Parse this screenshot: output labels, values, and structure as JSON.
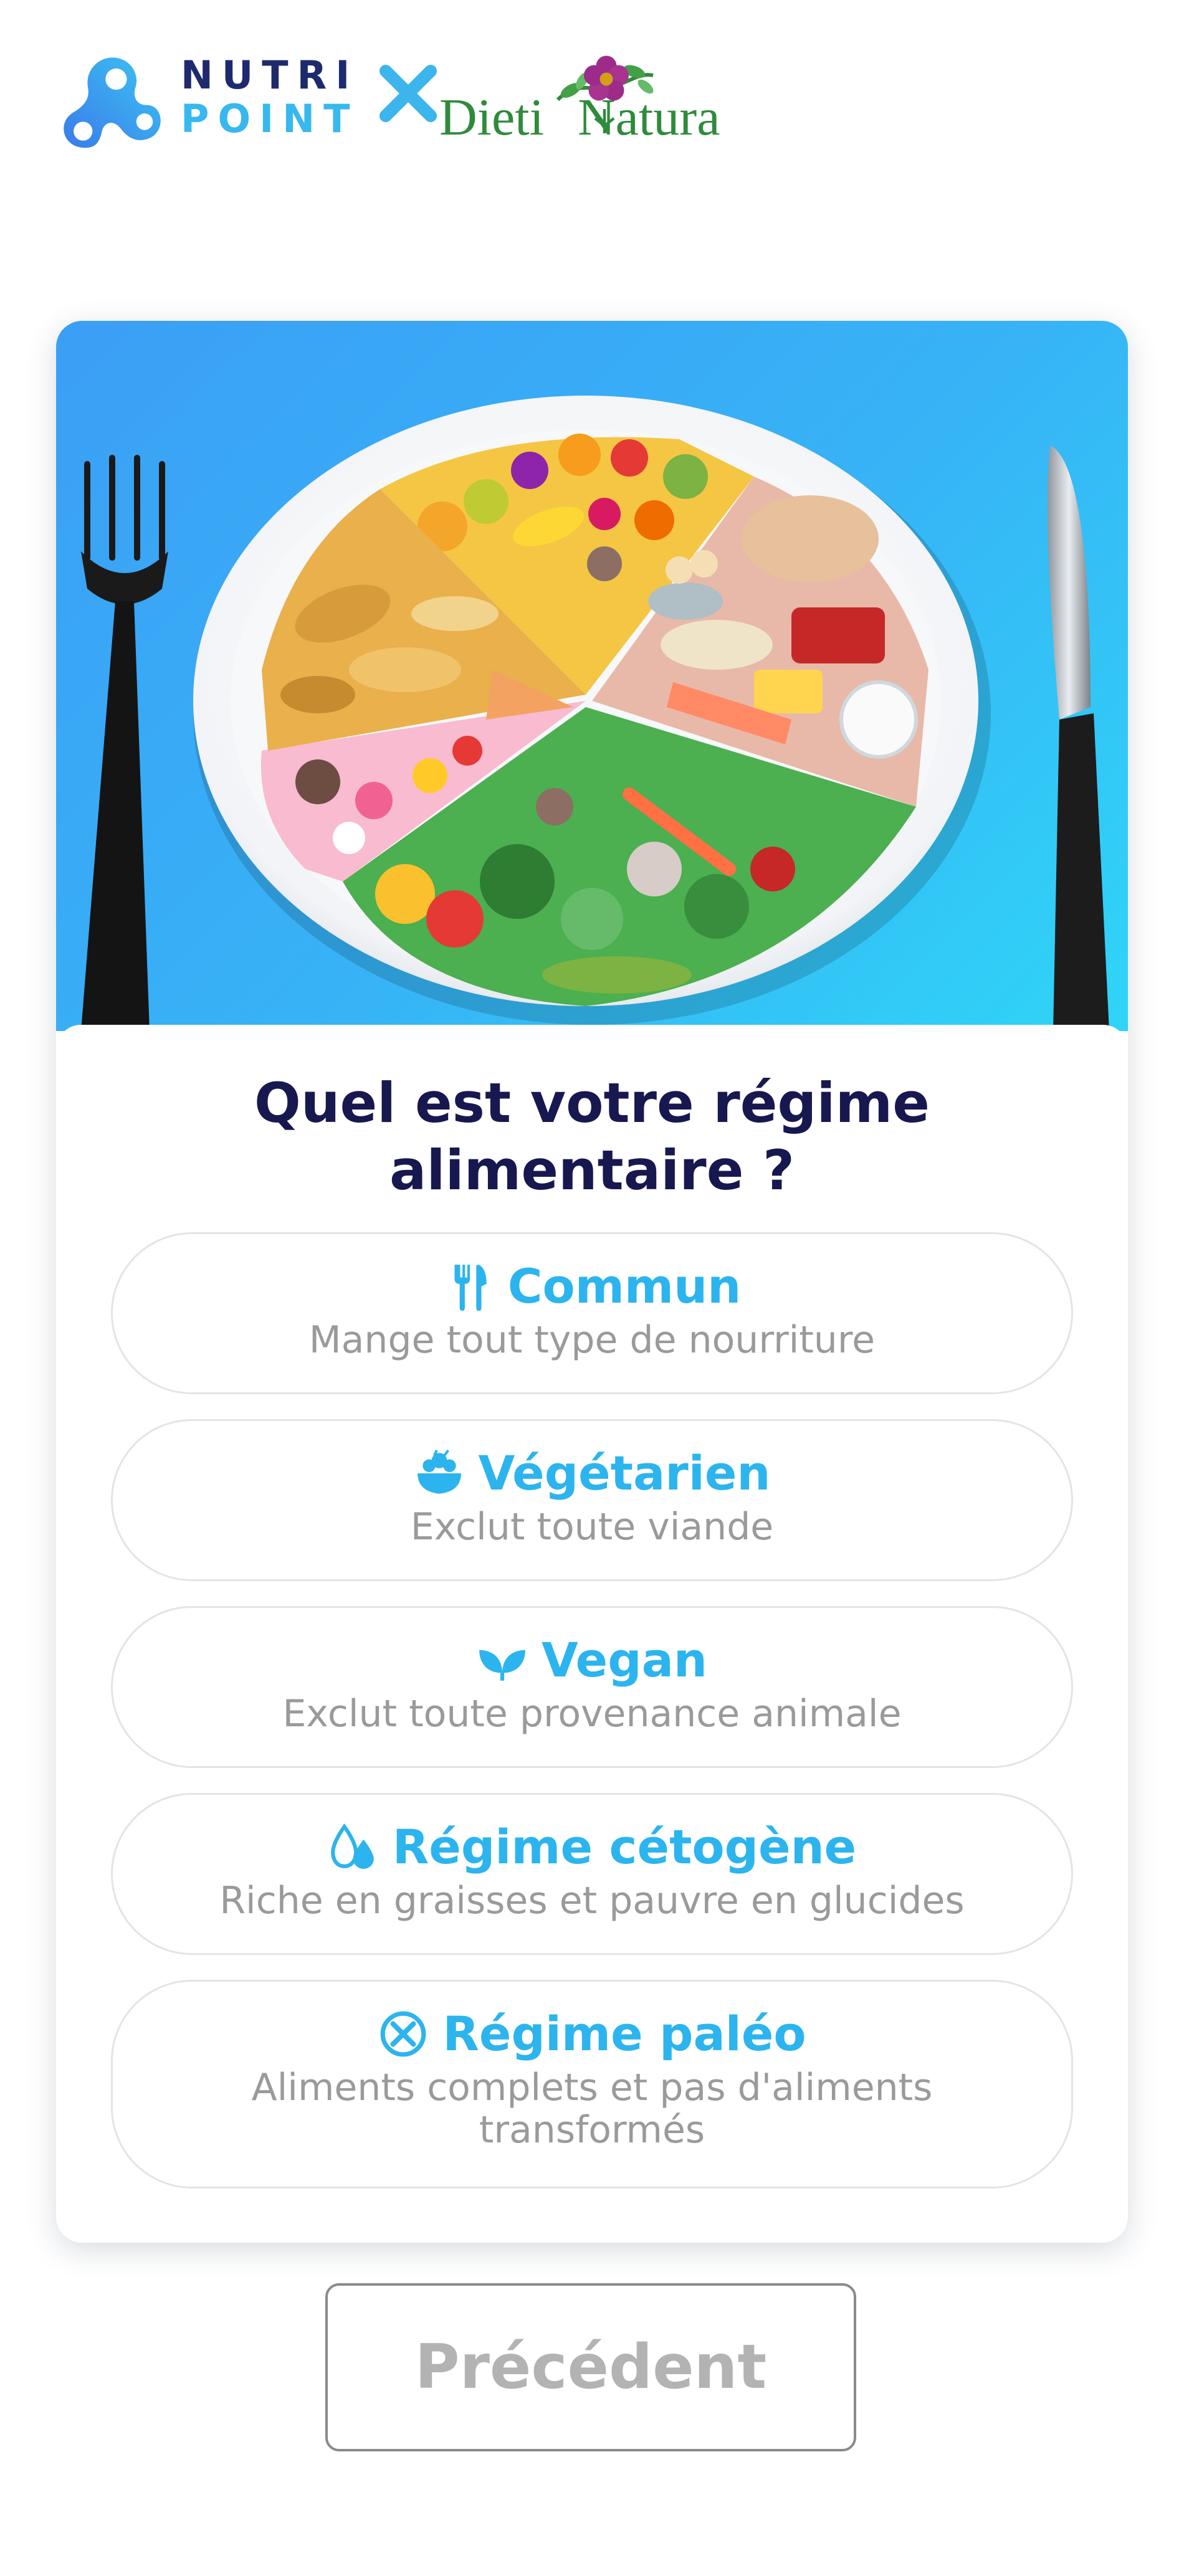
{
  "brand": {
    "nutripoint_line1": "NUTRI",
    "nutripoint_line2": "POINT",
    "partner_word1": "Dieti",
    "partner_word2": "Natura",
    "colors": {
      "navy": "#1e2a6e",
      "sky": "#37b8ee",
      "green": "#2e8b3b",
      "magenta": "#9c2b8a"
    }
  },
  "question": {
    "line1": "Quel est votre régime",
    "line2": "alimentaire ?"
  },
  "options": [
    {
      "icon": "fork-knife-icon",
      "title": "Commun",
      "subtitle": "Mange tout type de nourriture"
    },
    {
      "icon": "salad-bowl-icon",
      "title": "Végétarien",
      "subtitle": "Exclut toute viande"
    },
    {
      "icon": "leaves-icon",
      "title": "Vegan",
      "subtitle": "Exclut toute provenance animale"
    },
    {
      "icon": "drops-icon",
      "title": "Régime cétogène",
      "subtitle": "Riche en graisses et pauvre en glucides"
    },
    {
      "icon": "crossed-circle-icon",
      "title": "Régime paléo",
      "subtitle": "Aliments complets et pas d'aliments transformés"
    }
  ],
  "previous_button": {
    "label": "Précédent"
  },
  "colors": {
    "accent": "#2cb4ee",
    "heading": "#181850",
    "subtitle": "#9a9a9a",
    "option_border": "#e4e4e6",
    "hero_gradient_start": "#3b9ff5",
    "hero_gradient_end": "#2fd5f7"
  }
}
